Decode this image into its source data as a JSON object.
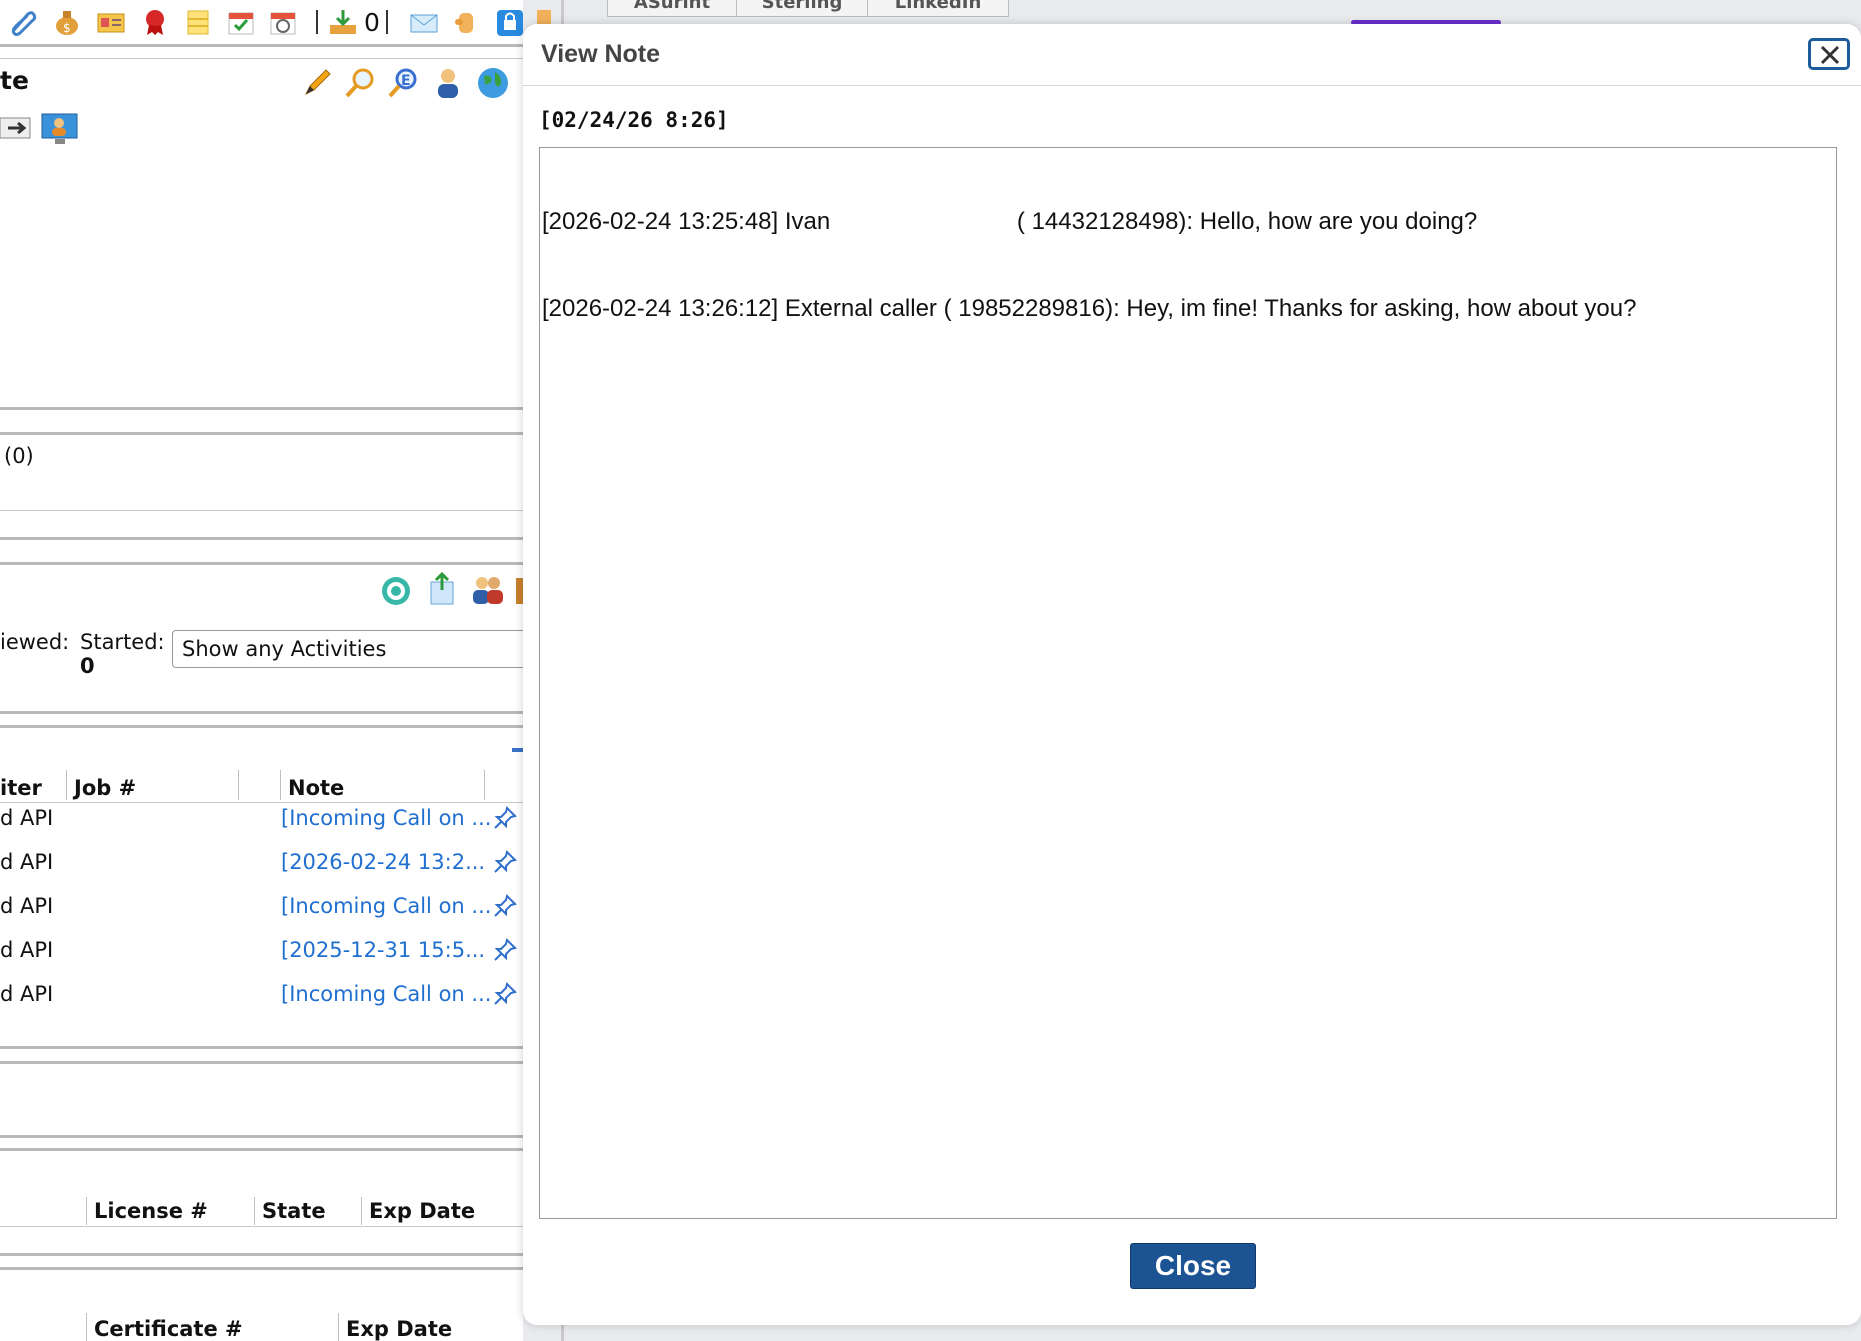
{
  "left_panel": {
    "toolbar": {
      "counter": "0"
    },
    "section_title_fragment": "te",
    "count_label": "(0)",
    "activities": {
      "viewed_label": "iewed:",
      "started_label": "Started:",
      "started_value": "0",
      "filter_select": "Show any Activities"
    },
    "table": {
      "headers": [
        "iter",
        "Job #",
        "Note"
      ],
      "rows": [
        {
          "source": "d API",
          "note": "[Incoming Call on ..."
        },
        {
          "source": "d API",
          "note": "[2026-02-24 13:2..."
        },
        {
          "source": "d API",
          "note": "[Incoming Call on ..."
        },
        {
          "source": "d API",
          "note": "[2025-12-31 15:5..."
        },
        {
          "source": "d API",
          "note": "[Incoming Call on ..."
        }
      ]
    },
    "license_headers": [
      "License #",
      "State",
      "Exp Date"
    ],
    "certificate_headers": [
      "Certificate #",
      "Exp Date"
    ]
  },
  "dialog": {
    "title": "View Note",
    "date": "[02/24/26 8:26]",
    "note_lines": [
      "[2026-02-24 13:25:48] Ivan                            ( 14432128498): Hello, how are you doing?",
      "[2026-02-24 13:26:12] External caller ( 19852289816): Hey, im fine! Thanks for asking, how about you?"
    ],
    "close_label": "Close"
  },
  "colors": {
    "link": "#1f6fd1",
    "close_button": "#1c5392",
    "title_text": "#444444"
  }
}
